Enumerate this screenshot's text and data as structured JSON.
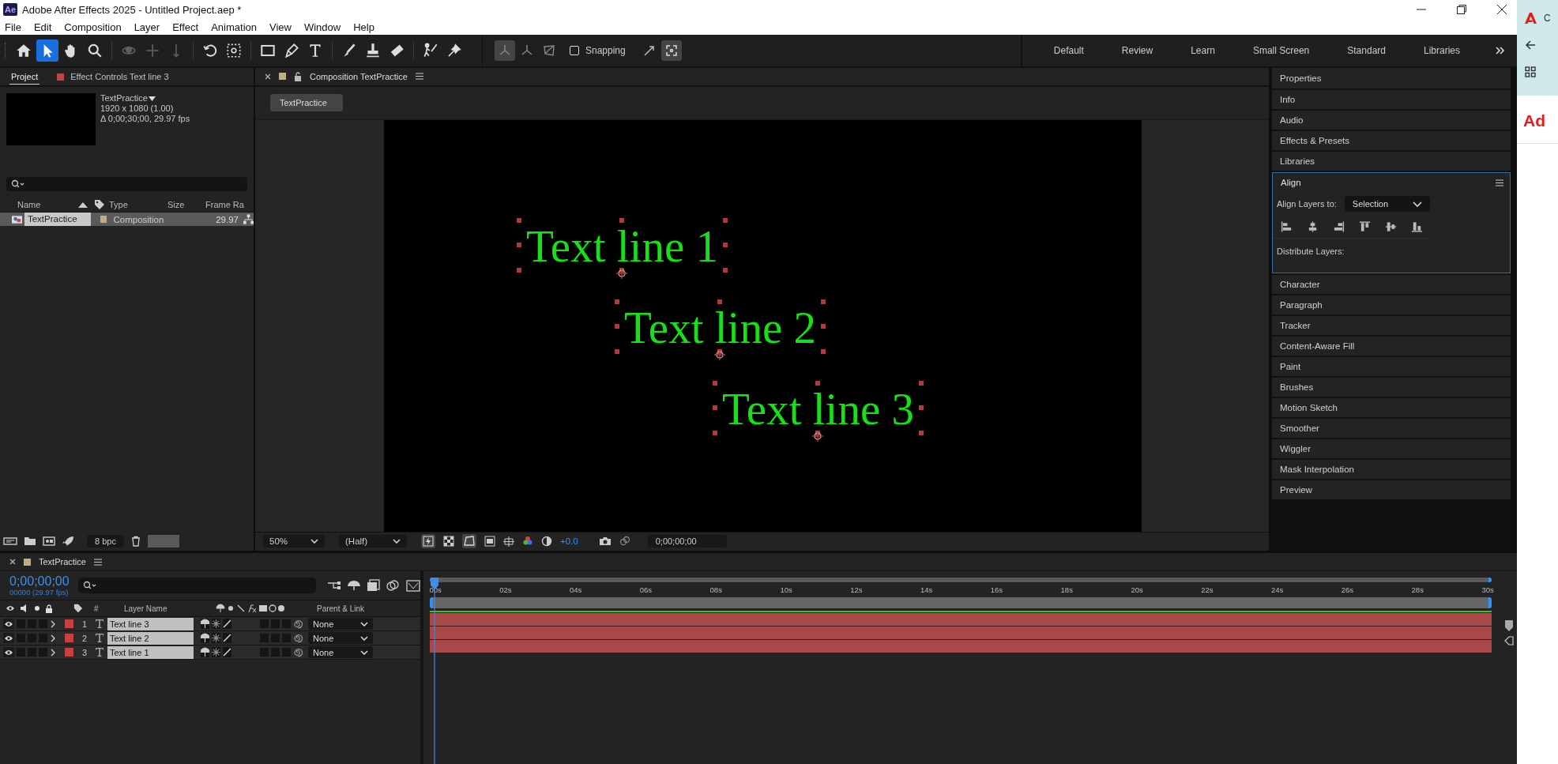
{
  "window": {
    "app_badge": "Ae",
    "title": "Adobe After Effects 2025 - Untitled Project.aep *"
  },
  "menu": [
    "File",
    "Edit",
    "Composition",
    "Layer",
    "Effect",
    "Animation",
    "View",
    "Window",
    "Help"
  ],
  "tool_groups": [
    [
      {
        "kind": "home",
        "selected": false
      },
      {
        "kind": "select",
        "selected": true
      },
      {
        "kind": "hand",
        "selected": false
      },
      {
        "kind": "zoom",
        "selected": false
      }
    ],
    [
      {
        "kind": "orbit",
        "selected": false
      },
      {
        "kind": "move",
        "selected": false
      },
      {
        "kind": "dolly",
        "selected": false
      }
    ],
    [
      {
        "kind": "rotate",
        "selected": false
      },
      {
        "kind": "anchor",
        "selected": false
      }
    ],
    [
      {
        "kind": "rect",
        "selected": false
      },
      {
        "kind": "pen",
        "selected": false
      },
      {
        "kind": "type",
        "selected": false
      }
    ],
    [
      {
        "kind": "brush",
        "selected": false
      },
      {
        "kind": "stamp",
        "selected": false
      },
      {
        "kind": "eraser",
        "selected": false
      }
    ],
    [
      {
        "kind": "roto",
        "selected": false
      },
      {
        "kind": "pin",
        "selected": false
      }
    ]
  ],
  "axis_tools": [
    {
      "kind": "axis",
      "selected": true
    },
    {
      "kind": "axis",
      "selected": false
    },
    {
      "kind": "axis-box",
      "selected": false
    }
  ],
  "snapping": {
    "label": "Snapping",
    "checked": false
  },
  "snap_tools": [
    {
      "kind": "snap-arrow",
      "selected": false
    },
    {
      "kind": "snap-frame",
      "selected": true
    }
  ],
  "workspaces": [
    "Default",
    "Review",
    "Learn",
    "Small Screen",
    "Standard",
    "Libraries"
  ],
  "project": {
    "tabs": [
      {
        "label": "Project",
        "selected": true
      },
      {
        "label": "Effect Controls Text line 3",
        "selected": false
      }
    ],
    "item": {
      "name": "TextPractice",
      "details": [
        "1920 x 1080 (1.00)",
        "Δ 0;00;30;00, 29.97 fps"
      ]
    },
    "columns": [
      "Name",
      "Type",
      "Size",
      "Frame Ra"
    ],
    "items": [
      {
        "name": "TextPractice",
        "type": "Composition",
        "frame_rate": "29.97",
        "selected": true
      }
    ],
    "bit_depth": "8 bpc"
  },
  "composition": {
    "tab": "Composition TextPractice",
    "breadcrumb": "TextPractice",
    "layers": [
      {
        "text": "Text line 1",
        "selected": true
      },
      {
        "text": "Text line 2",
        "selected": true
      },
      {
        "text": "Text line 3",
        "selected": true
      }
    ],
    "magnification": "50%",
    "resolution": "(Half)",
    "exposure": "+0.0",
    "timecode": "0;00;00;00"
  },
  "panels": [
    {
      "kind": "header",
      "label": "Properties"
    },
    {
      "kind": "header",
      "label": "Info"
    },
    {
      "kind": "header",
      "label": "Audio"
    },
    {
      "kind": "header",
      "label": "Effects & Presets"
    },
    {
      "kind": "header",
      "label": "Libraries"
    },
    {
      "kind": "align",
      "label": "Align",
      "align_to_label": "Align Layers to:",
      "align_to": "Selection",
      "distribute_label": "Distribute Layers:"
    },
    {
      "kind": "header",
      "label": "Character"
    },
    {
      "kind": "header",
      "label": "Paragraph"
    },
    {
      "kind": "header",
      "label": "Tracker"
    },
    {
      "kind": "header",
      "label": "Content-Aware Fill"
    },
    {
      "kind": "header",
      "label": "Paint"
    },
    {
      "kind": "header",
      "label": "Brushes"
    },
    {
      "kind": "header",
      "label": "Motion Sketch"
    },
    {
      "kind": "header",
      "label": "Smoother"
    },
    {
      "kind": "header",
      "label": "Wiggler"
    },
    {
      "kind": "header",
      "label": "Mask Interpolation"
    },
    {
      "kind": "header",
      "label": "Preview"
    }
  ],
  "timeline": {
    "tab": "TextPractice",
    "timecode": "0;00;00;00",
    "frames": "00000 (29.97 fps)",
    "columns": {
      "number": "#",
      "name": "Layer Name",
      "parent": "Parent & Link"
    },
    "ruler": [
      "00s",
      "02s",
      "04s",
      "06s",
      "08s",
      "10s",
      "12s",
      "14s",
      "16s",
      "18s",
      "20s",
      "22s",
      "24s",
      "26s",
      "28s",
      "30s"
    ],
    "layers": [
      {
        "number": "1",
        "name": "Text line 3",
        "parent": "None",
        "visible": true
      },
      {
        "number": "2",
        "name": "Text line 2",
        "parent": "None",
        "visible": true
      },
      {
        "number": "3",
        "name": "Text line 1",
        "parent": "None",
        "visible": true
      }
    ]
  },
  "browser": {
    "tab": "C",
    "heading": "Ad"
  }
}
